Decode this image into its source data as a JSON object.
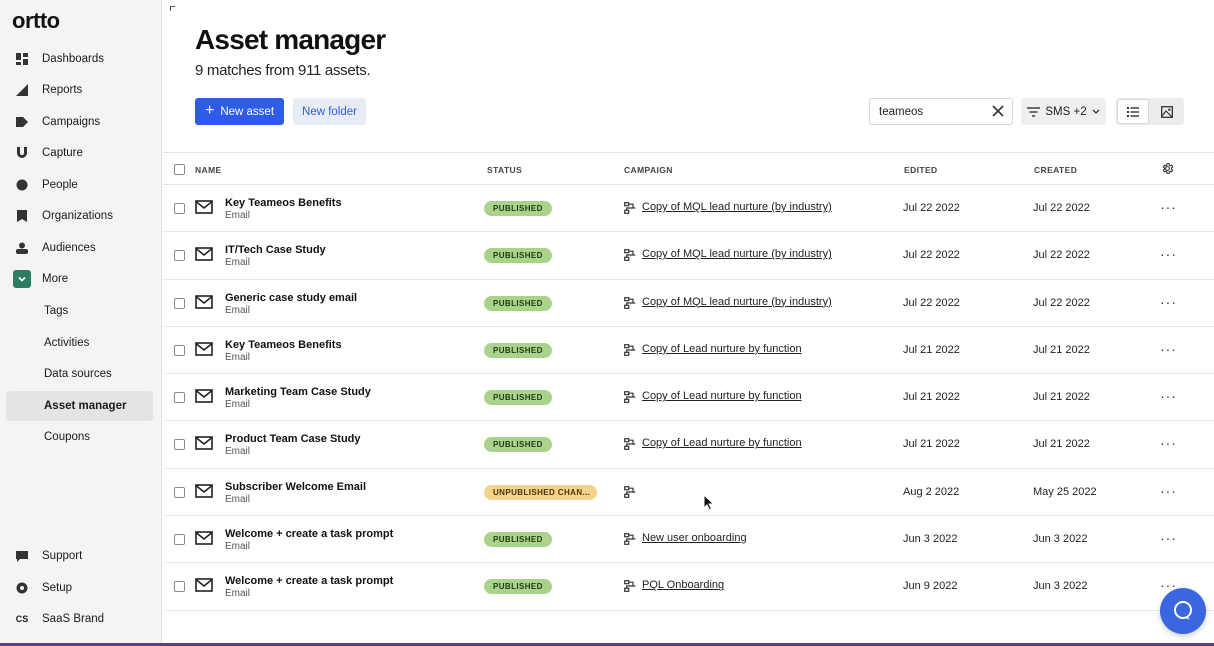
{
  "app": {
    "logo": "ortto"
  },
  "sidebar": {
    "items": [
      {
        "label": "Dashboards",
        "icon": "dashboard-icon"
      },
      {
        "label": "Reports",
        "icon": "reports-icon"
      },
      {
        "label": "Campaigns",
        "icon": "campaigns-icon"
      },
      {
        "label": "Capture",
        "icon": "capture-icon"
      },
      {
        "label": "People",
        "icon": "people-icon"
      },
      {
        "label": "Organizations",
        "icon": "organizations-icon"
      },
      {
        "label": "Audiences",
        "icon": "audiences-icon"
      },
      {
        "label": "More",
        "icon": "chevron-down-icon"
      }
    ],
    "sub_items": [
      {
        "label": "Tags"
      },
      {
        "label": "Activities"
      },
      {
        "label": "Data sources"
      },
      {
        "label": "Asset manager",
        "active": true
      },
      {
        "label": "Coupons"
      }
    ],
    "bottom_items": [
      {
        "label": "Support",
        "icon": "support-icon"
      },
      {
        "label": "Setup",
        "icon": "setup-icon"
      },
      {
        "label": "SaaS Brand",
        "badge": "CS"
      }
    ]
  },
  "header": {
    "title": "Asset manager",
    "subtitle": "9 matches from 911 assets."
  },
  "toolbar": {
    "new_asset_label": "New asset",
    "new_folder_label": "New folder",
    "search_value": "teameos",
    "filter_label": "SMS +2"
  },
  "table": {
    "columns": {
      "name": "NAME",
      "status": "STATUS",
      "campaign": "CAMPAIGN",
      "edited": "EDITED",
      "created": "CREATED"
    },
    "rows": [
      {
        "name": "Key Teameos Benefits",
        "type": "Email",
        "status": "PUBLISHED",
        "campaign": "Copy of MQL lead nurture (by industry)",
        "edited": "Jul 22 2022",
        "created": "Jul 22 2022"
      },
      {
        "name": "IT/Tech Case Study",
        "type": "Email",
        "status": "PUBLISHED",
        "campaign": "Copy of MQL lead nurture (by industry)",
        "edited": "Jul 22 2022",
        "created": "Jul 22 2022"
      },
      {
        "name": "Generic case study email",
        "type": "Email",
        "status": "PUBLISHED",
        "campaign": "Copy of MQL lead nurture (by industry)",
        "edited": "Jul 22 2022",
        "created": "Jul 22 2022"
      },
      {
        "name": "Key Teameos Benefits",
        "type": "Email",
        "status": "PUBLISHED",
        "campaign": "Copy of Lead nurture by function",
        "edited": "Jul 21 2022",
        "created": "Jul 21 2022"
      },
      {
        "name": "Marketing Team Case Study",
        "type": "Email",
        "status": "PUBLISHED",
        "campaign": "Copy of Lead nurture by function",
        "edited": "Jul 21 2022",
        "created": "Jul 21 2022"
      },
      {
        "name": "Product Team Case Study",
        "type": "Email",
        "status": "PUBLISHED",
        "campaign": "Copy of Lead nurture by function",
        "edited": "Jul 21 2022",
        "created": "Jul 21 2022"
      },
      {
        "name": "Subscriber Welcome Email",
        "type": "Email",
        "status": "UNPUBLISHED CHAN...",
        "campaign": "",
        "edited": "Aug 2 2022",
        "created": "May 25 2022"
      },
      {
        "name": "Welcome + create a task prompt",
        "type": "Email",
        "status": "PUBLISHED",
        "campaign": "New user onboarding",
        "edited": "Jun 3 2022",
        "created": "Jun 3 2022"
      },
      {
        "name": "Welcome + create a task prompt",
        "type": "Email",
        "status": "PUBLISHED",
        "campaign": "PQL Onboarding",
        "edited": "Jun 9 2022",
        "created": "Jun 3 2022"
      }
    ]
  },
  "colors": {
    "primary": "#2f5bea",
    "published": "#a9d38a",
    "unpublished": "#f5d38a",
    "more_accent": "#2e7d62"
  }
}
